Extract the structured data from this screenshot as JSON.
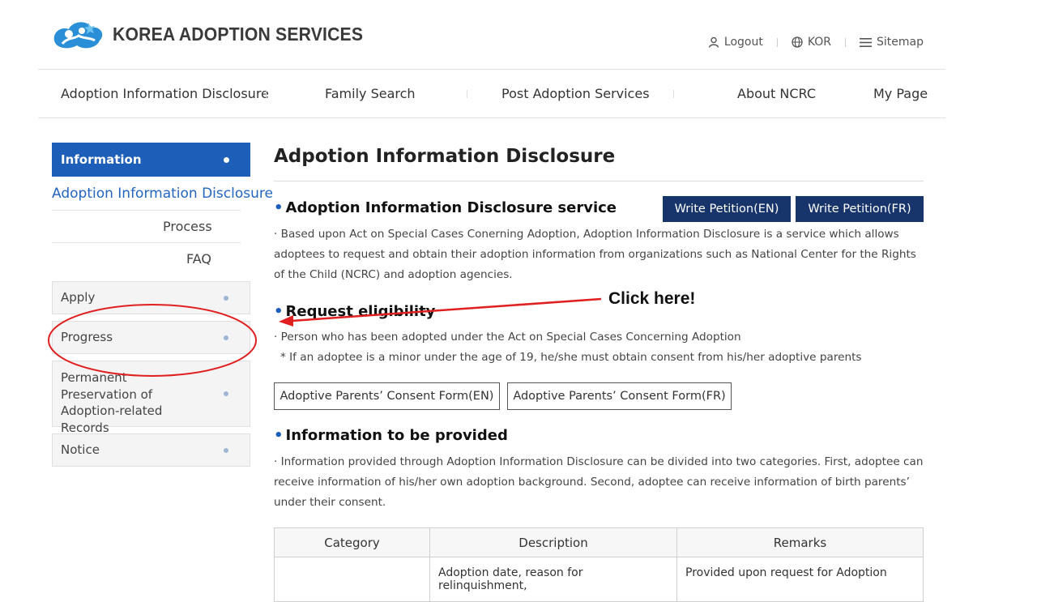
{
  "header": {
    "logo_text": "KOREA ADOPTION SERVICES",
    "logout": "Logout",
    "language": "KOR",
    "sitemap": "Sitemap"
  },
  "nav": {
    "items": [
      "Adoption Information Disclosure",
      "Family Search",
      "Post Adoption Services",
      "About NCRC",
      "My Page"
    ]
  },
  "sidebar": {
    "heading": "Information",
    "active_sub": "Adoption Information Disclosure",
    "subs": [
      "Process",
      "FAQ"
    ],
    "boxes": [
      "Apply",
      "Progress",
      "Permanent Preservation of Adoption-related Records",
      "Notice"
    ]
  },
  "main": {
    "title": "Adpotion Information Disclosure",
    "section1": {
      "title": "Adoption Information Disclosure service",
      "text": "· Based upon Act on Special Cases Conerning Adoption, Adoption Information Disclosure is a service which allows adoptees to request and obtain their adoption information from organizations such as National Center for the Rights of the Child (NCRC) and adoption agencies.",
      "btn_en": "Write Petition(EN)",
      "btn_fr": "Write Petition(FR)"
    },
    "section2": {
      "title": "Request eligibility",
      "line1": "· Person who has been adopted under the Act on Special Cases Concerning Adoption",
      "line2": "* If an adoptee is a minor under the age of 19, he/she must obtain consent from his/her adoptive parents",
      "btn_en": "Adoptive Parents’ Consent Form(EN)",
      "btn_fr": "Adoptive Parents’ Consent Form(FR)"
    },
    "section3": {
      "title": "Information to be provided",
      "text": "· Information provided through Adoption Information Disclosure can be divided into two categories. First, adoptee can receive information of his/her own adoption background. Second, adoptee can receive information of birth parents’ under their consent."
    },
    "table": {
      "headers": [
        "Category",
        "Description",
        "Remarks"
      ],
      "row1": [
        "",
        "Adoption date, reason for relinquishment,",
        "Provided upon request for Adoption"
      ]
    }
  },
  "annotation": {
    "text": "Click here!",
    "color": "#e02020"
  },
  "colors": {
    "brand_blue": "#1d5fb8",
    "navy": "#17346b"
  }
}
